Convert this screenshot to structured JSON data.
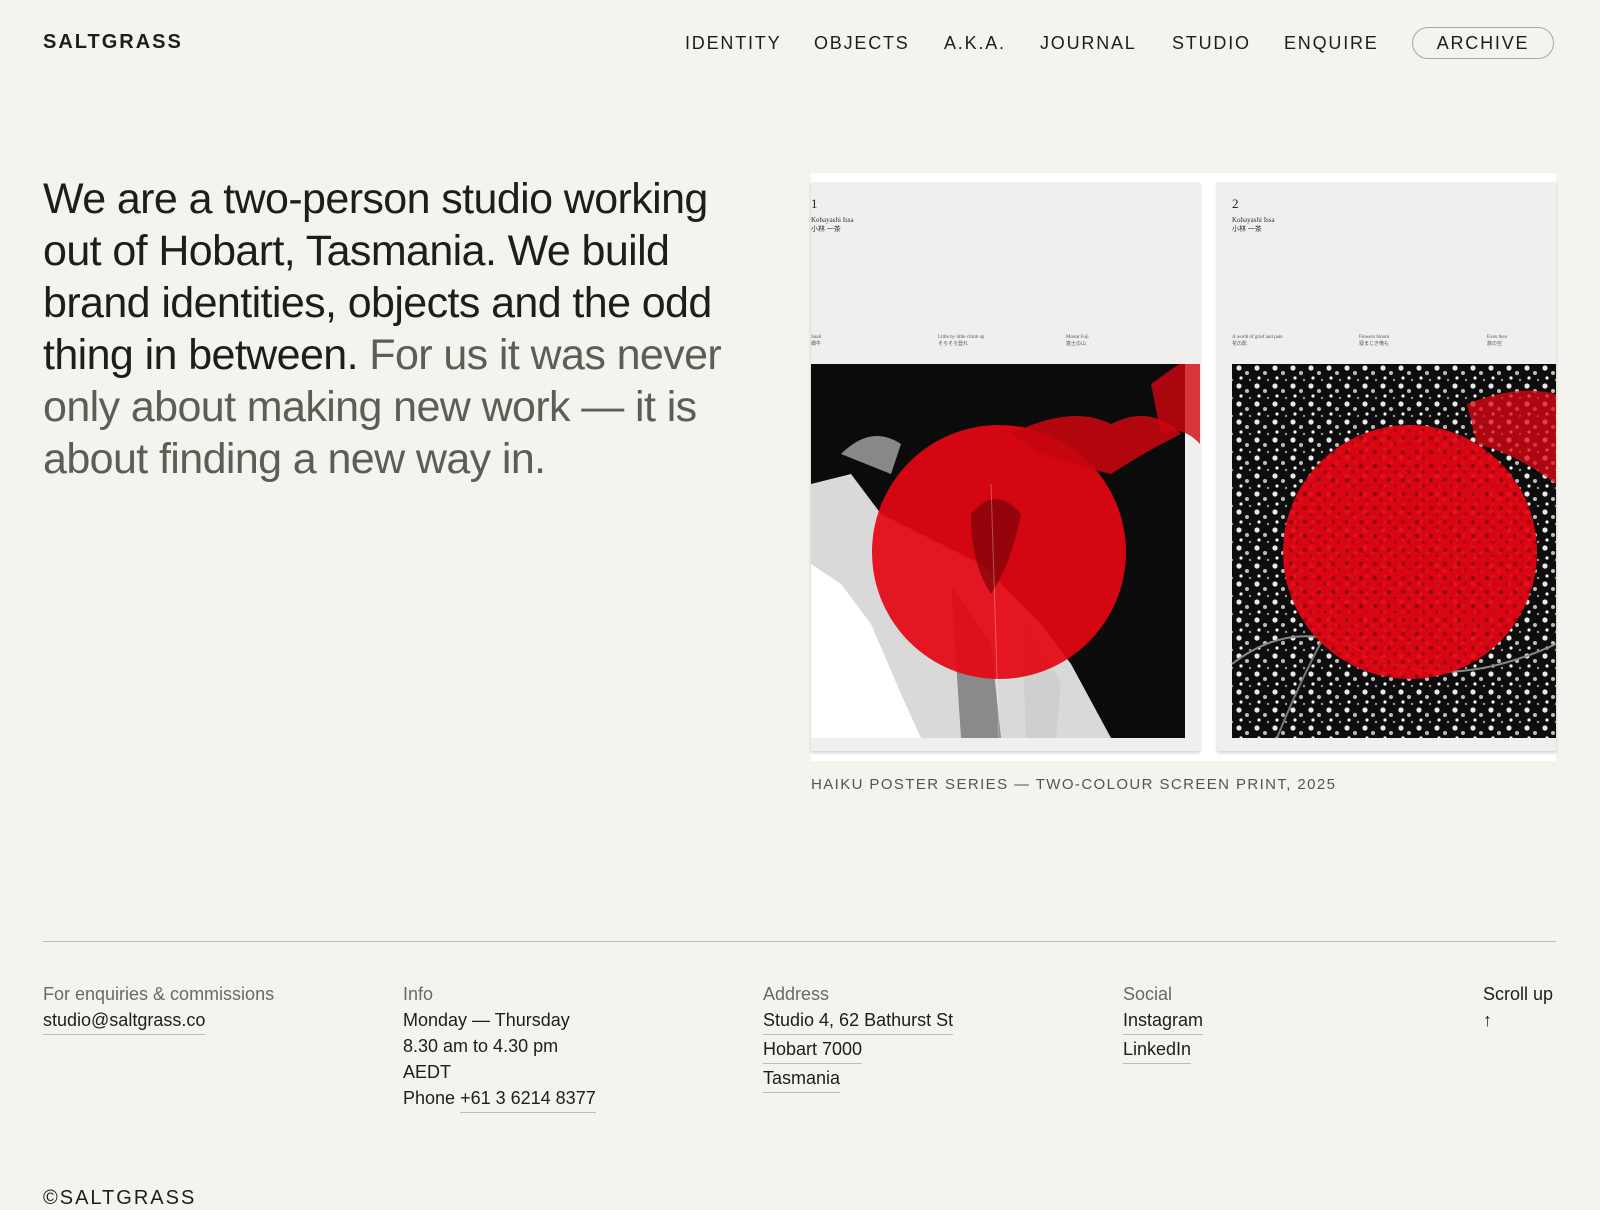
{
  "header": {
    "logo": "SALTGRASS",
    "nav": [
      "IDENTITY",
      "OBJECTS",
      "A.K.A.",
      "JOURNAL",
      "STUDIO",
      "ENQUIRE"
    ],
    "archive": "ARCHIVE"
  },
  "intro": {
    "primary": "We are a two-person studio working out of Hobart, Tasmania. We build brand identities, objects and the odd thing in between.",
    "secondary": "For us it was never only about making new work — it is about finding a new way in."
  },
  "feature": {
    "posters": [
      {
        "number": "1",
        "author_en": "Kobayashi Issa",
        "author_jp": "小林 一茶",
        "verses": [
          {
            "en": "Snail",
            "jp": "蝸牛"
          },
          {
            "en": "Little by little climb up",
            "jp": "そろそろ登れ"
          },
          {
            "en": "Mount Fuji",
            "jp": "富士の山"
          }
        ]
      },
      {
        "number": "2",
        "author_en": "Kobayashi Issa",
        "author_jp": "小林 一茶",
        "verses": [
          {
            "en": "A world of grief and pain",
            "jp": "花の影"
          },
          {
            "en": "Flowers bloom",
            "jp": "寝まじき俺も"
          },
          {
            "en": "Even then",
            "jp": "旅の空"
          }
        ]
      }
    ],
    "caption": "HAIKU POSTER SERIES — TWO-COLOUR SCREEN PRINT, 2025",
    "accent_color": "#e30613"
  },
  "footer": {
    "enquiries": {
      "label": "For enquiries & commissions",
      "email": "studio@saltgrass.co"
    },
    "info": {
      "label": "Info",
      "days": "Monday — Thursday",
      "hours": "8.30 am to 4.30 pm",
      "tz": "AEDT",
      "phone_label": "Phone",
      "phone": "+61 3 6214 8377"
    },
    "address": {
      "label": "Address",
      "line1": "Studio 4, 62 Bathurst St",
      "line2": "Hobart 7000",
      "line3": "Tasmania"
    },
    "social": {
      "label": "Social",
      "instagram": "Instagram",
      "linkedin": "LinkedIn"
    },
    "scroll": {
      "label": "Scroll up",
      "arrow": "↑"
    },
    "copyright": "©SALTGRASS"
  }
}
